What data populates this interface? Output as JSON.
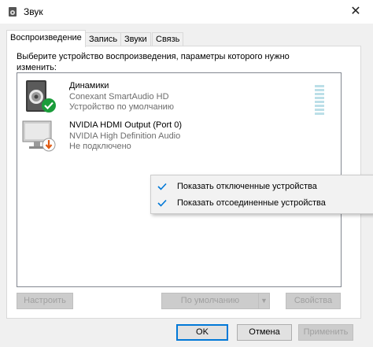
{
  "window": {
    "title": "Звук",
    "close_glyph": "✕"
  },
  "tabs": [
    {
      "label": "Воспроизведение",
      "active": true
    },
    {
      "label": "Запись",
      "active": false
    },
    {
      "label": "Звуки",
      "active": false
    },
    {
      "label": "Связь",
      "active": false
    }
  ],
  "instruction": "Выберите устройство воспроизведения, параметры которого нужно изменить:",
  "devices": [
    {
      "name": "Динамики",
      "driver": "Conexant SmartAudio HD",
      "status": "Устройство по умолчанию",
      "icon": "speaker-icon",
      "badge": "default-check-badge"
    },
    {
      "name": "NVIDIA HDMI Output (Port 0)",
      "driver": "NVIDIA High Definition Audio",
      "status": "Не подключено",
      "icon": "monitor-icon",
      "badge": "disconnected-arrow-badge"
    }
  ],
  "context_menu": {
    "items": [
      {
        "label": "Показать отключенные устройства",
        "checked": true
      },
      {
        "label": "Показать отсоединенные устройства",
        "checked": true
      }
    ]
  },
  "buttons": {
    "configure": "Настроить",
    "set_default": "По умолчанию",
    "properties": "Свойства",
    "ok": "OK",
    "cancel": "Отмена",
    "apply": "Применить"
  },
  "colors": {
    "accent": "#0078d7",
    "check_green": "#1a9c3a",
    "badge_orange": "#e05a12",
    "meter": "#bcdfe8"
  }
}
